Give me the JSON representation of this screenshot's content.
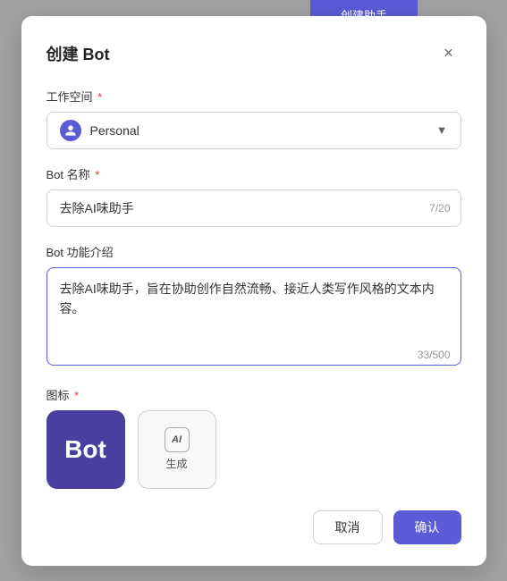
{
  "topBar": {
    "label": "创建助手"
  },
  "dialog": {
    "title": "创建 Bot",
    "closeLabel": "×"
  },
  "workspaceField": {
    "label": "工作空间",
    "value": "Personal"
  },
  "botNameField": {
    "label": "Bot 名称",
    "value": "去除AI味助手",
    "charCount": "7/20"
  },
  "botDescField": {
    "label": "Bot 功能介绍",
    "value": "去除AI味助手，旨在协助创作自然流畅、接近人类写作风格的文本内容。",
    "charCount": "33/500"
  },
  "iconField": {
    "label": "图标",
    "selectedIconText": "Bot",
    "generateLabel": "生成",
    "aiIconLabel": "AI"
  },
  "footer": {
    "cancelLabel": "取消",
    "confirmLabel": "确认"
  }
}
